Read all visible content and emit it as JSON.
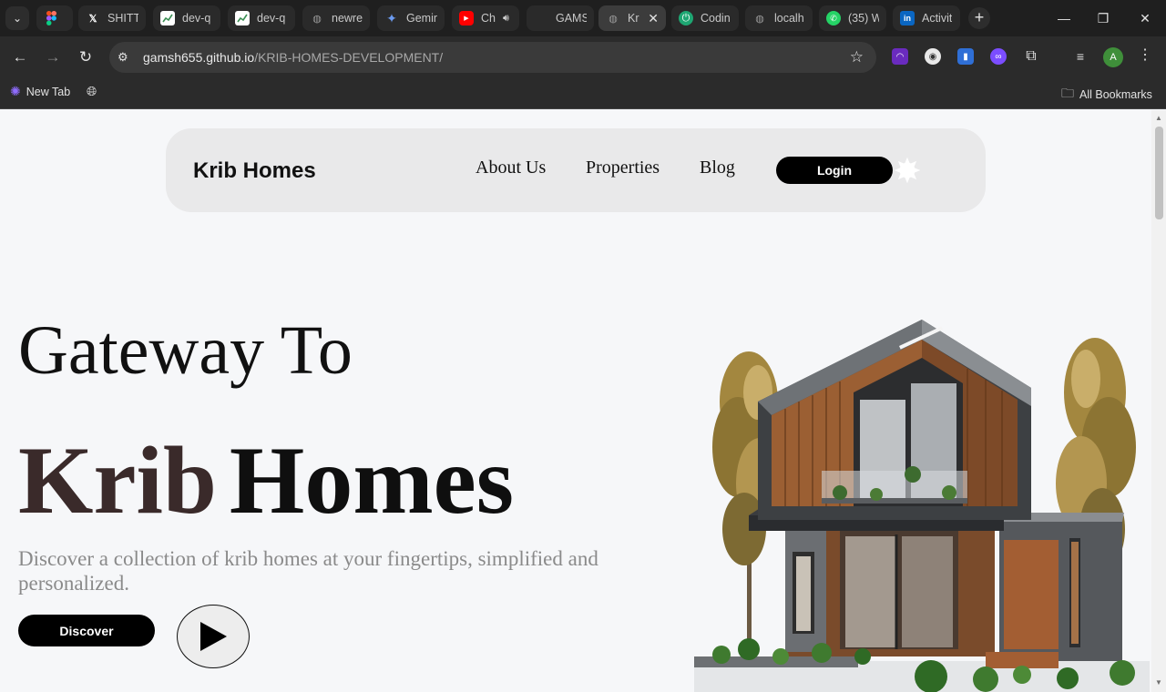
{
  "browser": {
    "tabs": [
      {
        "title": "",
        "icon": "figma-icon",
        "color": "#f24e1e"
      },
      {
        "title": "SHITTU",
        "icon": "x-icon",
        "color": "#000000"
      },
      {
        "title": "dev-q",
        "icon": "sheet-icon",
        "color": "#3b8f54"
      },
      {
        "title": "dev-q",
        "icon": "sheet-icon",
        "color": "#3b8f54"
      },
      {
        "title": "newre",
        "icon": "globe-icon",
        "color": "#888888"
      },
      {
        "title": "Gemin",
        "icon": "gemini-icon",
        "color": "#4a86e8"
      },
      {
        "title": "Ch",
        "icon": "youtube-icon",
        "color": "#ff0000"
      },
      {
        "title": "GAMS",
        "icon": "blank-icon",
        "color": "#444444"
      },
      {
        "title": "Kr",
        "icon": "globe-icon",
        "color": "#888888"
      },
      {
        "title": "Codin",
        "icon": "codin-icon",
        "color": "#1ea672"
      },
      {
        "title": "localh",
        "icon": "globe-icon",
        "color": "#888888"
      },
      {
        "title": "(35) W",
        "icon": "whatsapp-icon",
        "color": "#25d366"
      },
      {
        "title": "Activit",
        "icon": "linkedin-icon",
        "color": "#0a66c2"
      }
    ],
    "url_host": "gamsh655.github.io",
    "url_path": "/KRIB-HOMES-DEVELOPMENT/",
    "bookmarks": {
      "new_tab": "New Tab",
      "all_bookmarks": "All Bookmarks"
    },
    "profile_initial": "A"
  },
  "page": {
    "brand": "Krib Homes",
    "nav": {
      "about": "About Us",
      "properties": "Properties",
      "blog": "Blog",
      "login": "Login"
    },
    "hero": {
      "line1": "Gateway To",
      "line2_a": "Krib",
      "line2_b": "Homes",
      "subtitle": "Discover a collection of krib homes at your fingertips, simplified and personalized.",
      "cta": "Discover"
    }
  }
}
